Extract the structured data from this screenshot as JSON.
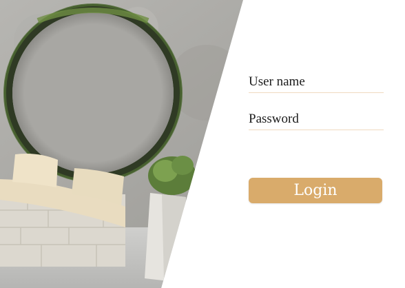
{
  "form": {
    "username_label": "User name",
    "password_label": "Password",
    "login_label": "Login"
  },
  "colors": {
    "accent": "#d9ab6b",
    "underline": "#f0d9c0",
    "wall": "#a9a9a6"
  }
}
